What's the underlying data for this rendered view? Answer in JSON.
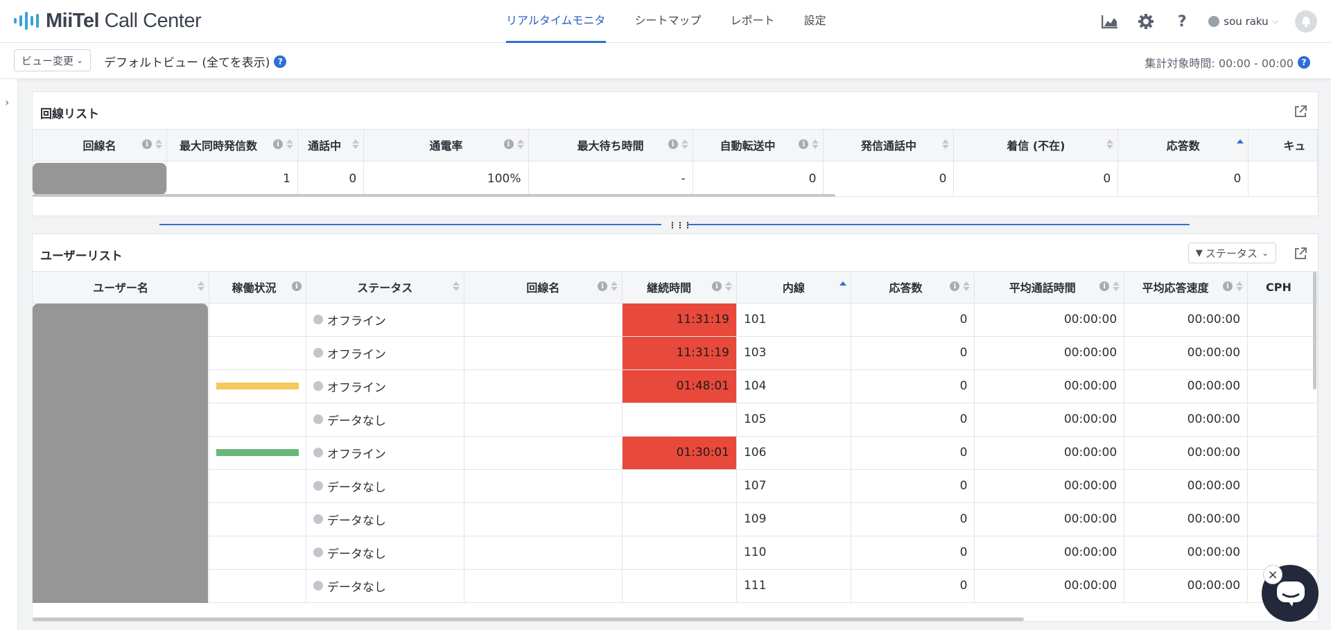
{
  "app": {
    "logo_brand": "MiiTel",
    "logo_product": "Call Center"
  },
  "nav": {
    "tabs": [
      {
        "label": "リアルタイムモニタ",
        "active": true
      },
      {
        "label": "シートマップ"
      },
      {
        "label": "レポート"
      },
      {
        "label": "設定"
      }
    ]
  },
  "header": {
    "user_name": "sou raku",
    "help": "?"
  },
  "viewbar": {
    "view_button": "ビュー変更",
    "view_title": "デフォルトビュー (全てを表示)",
    "aggregation": "集計対象時間: 00:00 - 00:00",
    "help_mark": "?"
  },
  "line_list": {
    "title": "回線リスト",
    "columns": [
      "回線名",
      "最大同時発信数",
      "通話中",
      "通電率",
      "最大待ち時間",
      "自動転送中",
      "発信通話中",
      "着信 (不在)",
      "応答数",
      "キュ"
    ],
    "row": [
      "",
      "1",
      "0",
      "100%",
      "-",
      "0",
      "0",
      "0",
      "0",
      ""
    ]
  },
  "user_list": {
    "title": "ユーザーリスト",
    "filter_label": "ステータス",
    "columns": [
      "ユーザー名",
      "稼働状況",
      "ステータス",
      "回線名",
      "継続時間",
      "内線",
      "応答数",
      "平均通話時間",
      "平均応答速度",
      "CPH"
    ],
    "rows": [
      {
        "status": "オフライン",
        "duration": "11:31:19",
        "ext": "101",
        "answers": "0",
        "avg_talk": "00:00:00",
        "avg_speed": "00:00:00",
        "bar": "",
        "red": true
      },
      {
        "status": "オフライン",
        "duration": "11:31:19",
        "ext": "103",
        "answers": "0",
        "avg_talk": "00:00:00",
        "avg_speed": "00:00:00",
        "bar": "",
        "red": true
      },
      {
        "status": "オフライン",
        "duration": "01:48:01",
        "ext": "104",
        "answers": "0",
        "avg_talk": "00:00:00",
        "avg_speed": "00:00:00",
        "bar": "yellow",
        "red": true
      },
      {
        "status": "データなし",
        "duration": "",
        "ext": "105",
        "answers": "0",
        "avg_talk": "00:00:00",
        "avg_speed": "00:00:00",
        "bar": "",
        "red": false
      },
      {
        "status": "オフライン",
        "duration": "01:30:01",
        "ext": "106",
        "answers": "0",
        "avg_talk": "00:00:00",
        "avg_speed": "00:00:00",
        "bar": "green",
        "red": true
      },
      {
        "status": "データなし",
        "duration": "",
        "ext": "107",
        "answers": "0",
        "avg_talk": "00:00:00",
        "avg_speed": "00:00:00",
        "bar": "",
        "red": false
      },
      {
        "status": "データなし",
        "duration": "",
        "ext": "109",
        "answers": "0",
        "avg_talk": "00:00:00",
        "avg_speed": "00:00:00",
        "bar": "",
        "red": false
      },
      {
        "status": "データなし",
        "duration": "",
        "ext": "110",
        "answers": "0",
        "avg_talk": "00:00:00",
        "avg_speed": "00:00:00",
        "bar": "",
        "red": false
      },
      {
        "status": "データなし",
        "duration": "",
        "ext": "111",
        "answers": "0",
        "avg_talk": "00:00:00",
        "avg_speed": "00:00:00",
        "bar": "",
        "red": false
      }
    ]
  },
  "colors": {
    "accent": "#2f6fd3",
    "alert": "#e9493a",
    "bar_yellow": "#f5c95c",
    "bar_green": "#66b978"
  }
}
